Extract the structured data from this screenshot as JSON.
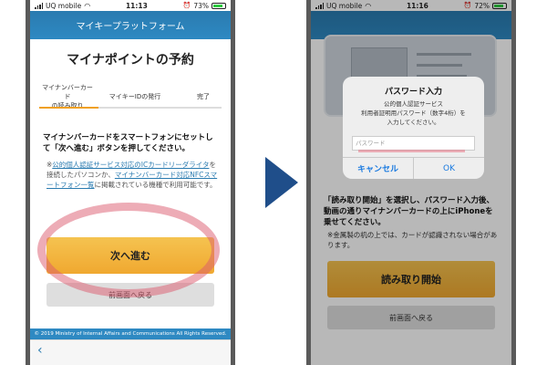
{
  "left": {
    "status": {
      "carrier": "UQ mobile",
      "time": "11:13",
      "battery": "73%"
    },
    "header_title": "マイキープラットフォーム",
    "page_title": "マイナポイントの予約",
    "steps": [
      {
        "line1": "マイナンバーカード",
        "line2": "の読み取り"
      },
      {
        "line1": "マイキーIDの発行",
        "line2": ""
      },
      {
        "line1": "完了",
        "line2": ""
      }
    ],
    "instruction": "マイナンバーカードをスマートフォンにセットして「次へ進む」ボタンを押してください。",
    "note_prefix": "※",
    "note_link1": "公的個人認証サービス対応のICカードリーダライタ",
    "note_mid": "を接続したパソコンか、",
    "note_link2": "マイナンバーカード対応NFCスマートフォン一覧",
    "note_suffix": "に掲載されている機種で利用可能です。",
    "next_button": "次へ進む",
    "back_button": "前画面へ戻る",
    "copyright": "© 2019 Ministry of Internal Affairs and Communications All Rights Reserved.",
    "nav_back": "‹"
  },
  "right": {
    "status": {
      "carrier": "UQ mobile",
      "time": "11:16",
      "battery": "72%"
    },
    "dialog": {
      "title": "パスワード入力",
      "message_line1": "公的個人認証サービス",
      "message_line2": "利用者証明用パスワード（数字4桁）を",
      "message_line3": "入力してください。",
      "input_placeholder": "パスワード",
      "cancel": "キャンセル",
      "ok": "OK"
    },
    "instruction": "「読み取り開始」を選択し、パスワード入力後、動画の通りマイナンバーカードの上にiPhoneを乗せてください。",
    "note": "※金属製の机の上では、カードが認識されない場合があります。",
    "start_button": "読み取り開始",
    "back_button": "前画面へ戻る"
  },
  "colors": {
    "header_blue": "#2e89c2",
    "button_orange": "#f0a830",
    "arrow_navy": "#1f4e8a",
    "highlight_pink": "#dc5a6e"
  },
  "icons": [
    "wifi-icon",
    "signal-icon",
    "battery-icon",
    "alarm-icon",
    "chevron-left-icon",
    "arrow-right-icon"
  ]
}
